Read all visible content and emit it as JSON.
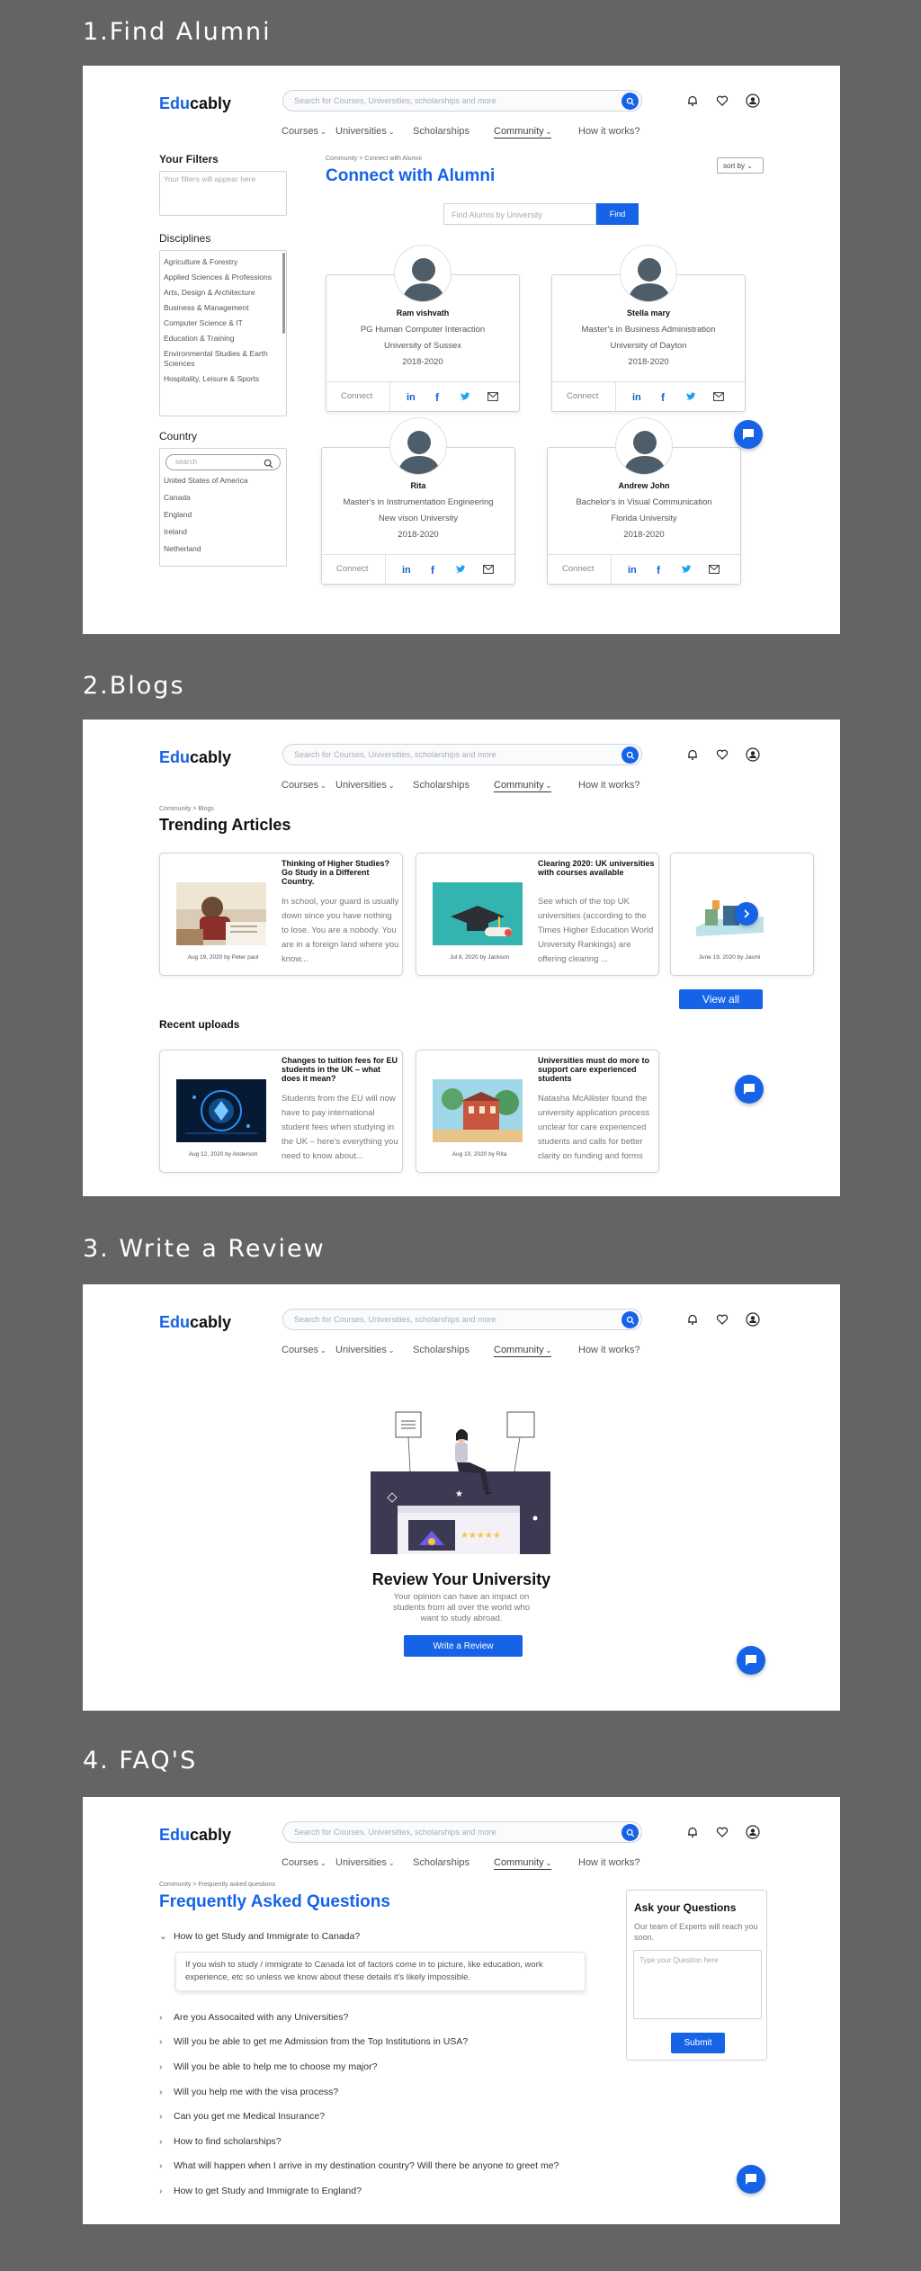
{
  "sections": {
    "s1": "1.Find Alumni",
    "s2": "2.Blogs",
    "s3": "3. Write a Review",
    "s4": "4. FAQ'S"
  },
  "header": {
    "logo_blue": "Edu",
    "logo_dark": "cably",
    "search_placeholder": "Search for Courses, Universities, scholarships and more",
    "nav": {
      "courses": "Courses",
      "universities": "Universities",
      "scholarships": "Scholarships",
      "community": "Community",
      "how": "How it works?"
    }
  },
  "alumni": {
    "filters_title": "Your Filters",
    "filters_placeholder": "Your filters will appear here",
    "disciplines_title": "Disciplines",
    "disciplines": [
      "Agriculture & Forestry",
      "Applied Sciences & Professions",
      "Arts, Design & Architecture",
      "Business & Management",
      "Computer Science & IT",
      "Education & Training",
      "Environmental Studies & Earth Sciences",
      "Hospitality, Leisure & Sports"
    ],
    "country_title": "Country",
    "country_search_placeholder": "search",
    "countries": [
      "United States of America",
      "Canada",
      "England",
      "Ireland",
      "Netherland"
    ],
    "crumb_a": "Community",
    "crumb_b": "Connect with Alumni",
    "title": "Connect with Alumni",
    "sort": "sort by",
    "find_placeholder": "Find Alumni by University",
    "find_btn": "Find",
    "connect": "Connect",
    "cards": [
      {
        "name": "Ram vishvath",
        "course": "PG Human Computer Interaction",
        "university": "University of Sussex",
        "years": "2018-2020"
      },
      {
        "name": "Stella mary",
        "course": "Master's in Business Administration",
        "university": "University of Dayton",
        "years": "2018-2020"
      },
      {
        "name": "Rita",
        "course": "Master's in Instrumentation Engineering",
        "university": "New vison University",
        "years": "2018-2020"
      },
      {
        "name": "Andrew John",
        "course": "Bachelor's in Visual Communication",
        "university": "Florida University",
        "years": "2018-2020"
      }
    ]
  },
  "blogs": {
    "crumb_a": "Community",
    "crumb_b": "Blogs",
    "trending_title": "Trending Articles",
    "trending": [
      {
        "title": "Thinking of Higher Studies? Go Study in a Different Country.",
        "excerpt": "In school, your guard is usually down since you have nothing to lose. You are a nobody. You are in a foreign land where you know...",
        "meta": "Aug 19, 2020 by Peter paul"
      },
      {
        "title": "Clearing 2020: UK universities with courses available",
        "excerpt": "See which of the top UK universities (according to the Times Higher Education World University Rankings) are offering clearing ...",
        "meta": "Jul 8, 2020 by Jackson"
      },
      {
        "meta": "June 19, 2020 by Jasmi"
      }
    ],
    "view_all": "View all",
    "recent_title": "Recent uploads",
    "recent": [
      {
        "title": "Changes to tuition fees for EU students in the UK – what does it mean?",
        "excerpt": "Students from the EU will now have to pay international student fees when studying in the UK – here's everything you need to know about...",
        "meta": "Aug 12, 2020 by Anderson"
      },
      {
        "title": "Universities must do more to support care experienced students",
        "excerpt": "Natasha McAllister found the university application process unclear for care experienced students and calls for better clarity on funding and forms",
        "meta": "Aug 10, 2020 by Rita"
      }
    ]
  },
  "review": {
    "title": "Review Your University",
    "text": "Your opinion can have an impact on students from all over the world who want to study abroad.",
    "button": "Write a Review"
  },
  "faq": {
    "crumb_a": "Community",
    "crumb_b": "Frequently asked questions",
    "title": "Frequently Asked Questions",
    "open_question": "How to get Study and Immigrate to Canada?",
    "open_answer": "If you wish to study / immigrate to Canada lot of factors come in to picture, like education, work experience, etc so unless we know about these details it's likely impossible.",
    "questions": [
      "Are you Assocaited with any Universities?",
      "Will you be able to get me Admission from the Top Institutions in USA?",
      "Will you be able to help me to choose my major?",
      "Will you help me with the visa process?",
      "Can you get me Medical Insurance?",
      "How to find scholarships?",
      "What will happen when I arrive in my destination country? Will there be anyone to greet me?",
      "How to get Study and Immigrate to England?"
    ],
    "ask_title": "Ask your Questions",
    "ask_text": "Our team of Experts will reach you soon.",
    "ask_placeholder": "Type your Question here",
    "submit": "Submit"
  },
  "colors": {
    "accent": "#1763e8",
    "background": "#646464",
    "avatar": "#4d5d69"
  }
}
